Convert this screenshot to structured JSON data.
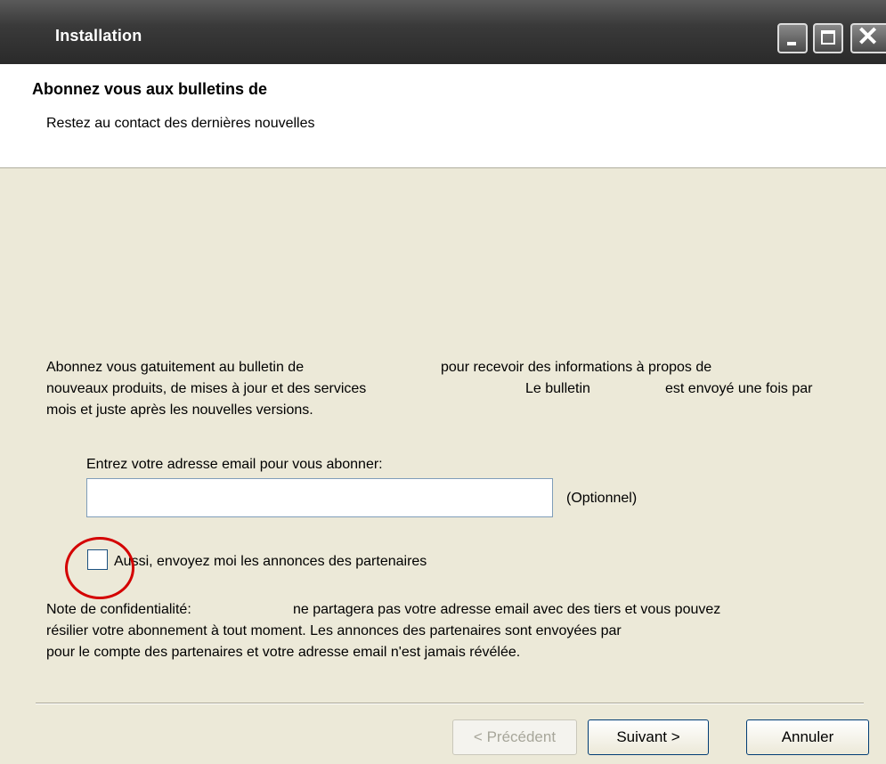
{
  "window": {
    "title": "Installation",
    "controls": {
      "minimize": "minimize-icon",
      "maximize": "maximize-icon",
      "close": "close-icon"
    }
  },
  "header": {
    "title": "Abonnez vous aux bulletins de",
    "subtitle": "Restez au contact des dernières nouvelles"
  },
  "body": {
    "intro_line1_a": "Abonnez vous gatuitement au bulletin de",
    "intro_line1_b": "pour recevoir des informations à propos de",
    "intro_line2_a": "nouveaux produits, de mises à jour et des services",
    "intro_line2_b": "Le bulletin",
    "intro_line2_c": "est envoyé une fois par",
    "intro_line3": "mois et juste après les nouvelles versions.",
    "email_label": "Entrez votre adresse email pour vous abonner:",
    "email_value": "",
    "optional_label": "(Optionnel)",
    "partner_checkbox_label": "Aussi, envoyez moi les annonces des partenaires",
    "partner_checkbox_checked": false,
    "privacy_line1_a": "Note de confidentialité:",
    "privacy_line1_b": "ne partagera pas votre adresse email avec des tiers et vous pouvez",
    "privacy_line2": "résilier votre abonnement à tout moment. Les annonces des partenaires sont envoyées par",
    "privacy_line3": "pour le compte des partenaires et votre adresse email n'est jamais révélée."
  },
  "buttons": {
    "previous": "< Précédent",
    "next": "Suivant >",
    "cancel": "Annuler"
  },
  "annotation": {
    "highlight_color": "#d40000"
  }
}
